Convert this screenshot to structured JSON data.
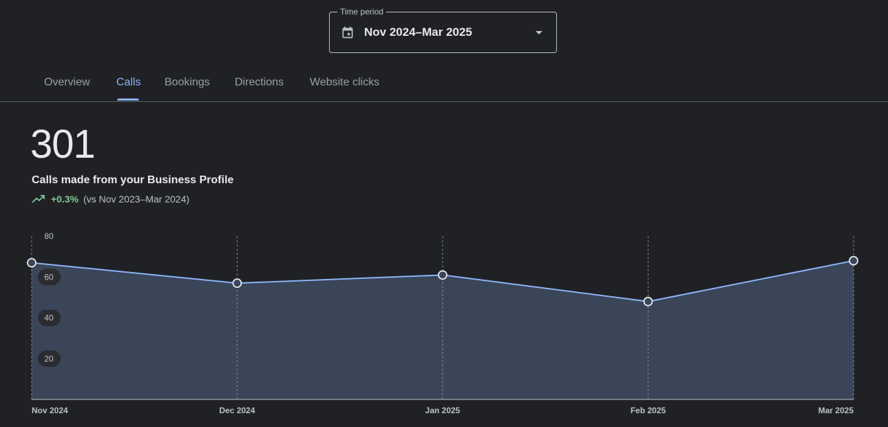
{
  "time_period": {
    "label": "Time period",
    "value": "Nov 2024–Mar 2025"
  },
  "tabs": [
    {
      "label": "Overview",
      "active": false
    },
    {
      "label": "Calls",
      "active": true
    },
    {
      "label": "Bookings",
      "active": false
    },
    {
      "label": "Directions",
      "active": false
    },
    {
      "label": "Website clicks",
      "active": false
    }
  ],
  "metric": {
    "total": "301",
    "label": "Calls made from your Business Profile",
    "change": "+0.3%",
    "comparison": "(vs Nov 2023–Mar 2024)"
  },
  "colors": {
    "accent": "#8ab4f8",
    "line": "#8ab4f8",
    "area": "#3a4558",
    "positive": "#81c995"
  },
  "chart_data": {
    "type": "area",
    "x": [
      "Nov 2024",
      "Dec 2024",
      "Jan 2025",
      "Feb 2025",
      "Mar 2025"
    ],
    "series": [
      {
        "values": [
          67,
          57,
          61,
          48,
          68
        ]
      }
    ],
    "yticks": [
      20,
      40,
      60,
      80
    ],
    "ylim": [
      0,
      80
    ],
    "grid": "vertical-dashed"
  }
}
